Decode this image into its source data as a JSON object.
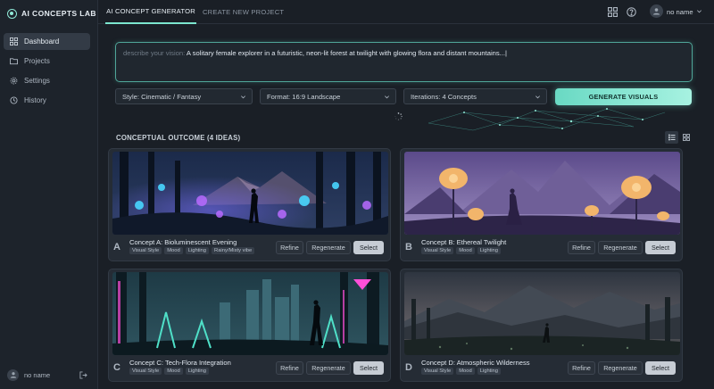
{
  "app": {
    "brand": "AI CONCEPTS LAB"
  },
  "sidebar": {
    "items": [
      {
        "label": "Dashboard",
        "icon": "grid-icon",
        "active": true
      },
      {
        "label": "Projects",
        "icon": "folder-icon",
        "active": false
      },
      {
        "label": "Settings",
        "icon": "gear-icon",
        "active": false
      },
      {
        "label": "History",
        "icon": "clock-icon",
        "active": false
      }
    ],
    "user": {
      "name": "no name"
    }
  },
  "topbar": {
    "tabs": [
      {
        "label": "AI CONCEPT GENERATOR",
        "active": true
      },
      {
        "label": "CREATE NEW PROJECT",
        "active": false
      }
    ],
    "user_name": "no name"
  },
  "prompt": {
    "label": "describe your vision: ",
    "value": "A solitary female explorer in a futuristic, neon-lit forest at twilight with glowing flora and distant mountains...|"
  },
  "controls": {
    "style": "Style: Cinematic / Fantasy",
    "format": "Format: 16:9 Landscape",
    "iterations": "Iterations: 4 Concepts",
    "generate_label": "GENERATE VISUALS"
  },
  "results": {
    "title": "CONCEPTUAL OUTCOME (4 IDEAS)",
    "buttons": {
      "refine": "Refine",
      "regenerate": "Regenerate",
      "select": "Select"
    },
    "cards": [
      {
        "letter": "A",
        "title": "Concept A: Bioluminescent Evening",
        "tags": [
          "Visual Style",
          "Mood",
          "Lighting",
          "Rainy/Misty vibe"
        ]
      },
      {
        "letter": "B",
        "title": "Concept B: Ethereal Twilight",
        "tags": [
          "Visual Style",
          "Mood",
          "Lighting"
        ]
      },
      {
        "letter": "C",
        "title": "Concept C: Tech-Flora Integration",
        "tags": [
          "Visual Style",
          "Mood",
          "Lighting"
        ]
      },
      {
        "letter": "D",
        "title": "Concept D: Atmospheric Wilderness",
        "tags": [
          "Visual Style",
          "Mood",
          "Lighting"
        ]
      }
    ]
  },
  "colors": {
    "accent": "#7ce6cf",
    "background": "#1a1f26",
    "select_button": "#c6ccd4"
  }
}
